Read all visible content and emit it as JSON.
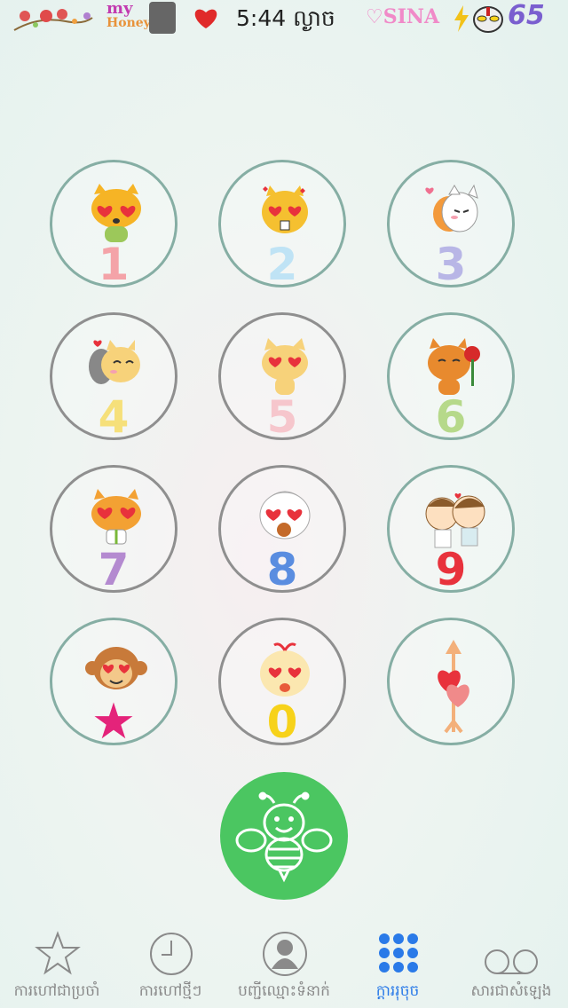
{
  "status_bar": {
    "time": "5:44 ល្ងាច",
    "sticker_text_top": "my",
    "sticker_text_bottom": "Honey",
    "sina": "SINA",
    "battery": "65",
    "icons": [
      "birds-icon",
      "avatar",
      "heart-icon",
      "bolt-icon",
      "ultraman-icon"
    ]
  },
  "keypad": {
    "keys": [
      {
        "digit": "1",
        "color": "#f4a3a8",
        "sticker": "tiger-heart-eyes"
      },
      {
        "digit": "2",
        "color": "#bfe3f5",
        "sticker": "hamster-heart-eyes"
      },
      {
        "digit": "3",
        "color": "#b8b6e6",
        "sticker": "kitten-blushing"
      },
      {
        "digit": "4",
        "color": "#f6e07a",
        "sticker": "cats-hugging"
      },
      {
        "digit": "5",
        "color": "#f6c6cc",
        "sticker": "cat-heart-eyes"
      },
      {
        "digit": "6",
        "color": "#b6d98a",
        "sticker": "tiger-with-rose"
      },
      {
        "digit": "7",
        "color": "#b48ad0",
        "sticker": "tiger-with-gift"
      },
      {
        "digit": "8",
        "color": "#5a8de0",
        "sticker": "bun-heart-eyes"
      },
      {
        "digit": "9",
        "color": "#e8323c",
        "sticker": "couple-kissing"
      },
      {
        "digit": "★",
        "color": "#e4237a",
        "sticker": "monkey-heart-eyes"
      },
      {
        "digit": "0",
        "color": "#f7d21a",
        "sticker": "sprout-heart-eyes"
      },
      {
        "digit": "",
        "color": "#e84a52",
        "sticker": "hearts-arrow"
      }
    ]
  },
  "call_button": {
    "icon": "bee-icon",
    "color": "#4bc661"
  },
  "tabs": [
    {
      "label": "ការហៅជាប្រចាំ",
      "icon": "star-icon",
      "active": false
    },
    {
      "label": "ការហៅថ្មីៗ",
      "icon": "clock-icon",
      "active": false
    },
    {
      "label": "បញ្ជីឈ្មោះទំនាក់",
      "icon": "contact-icon",
      "active": false
    },
    {
      "label": "ក្ដាររុចុច",
      "icon": "keypad-icon",
      "active": true
    },
    {
      "label": "សារជាសំឡេង",
      "icon": "voicemail-icon",
      "active": false
    }
  ]
}
